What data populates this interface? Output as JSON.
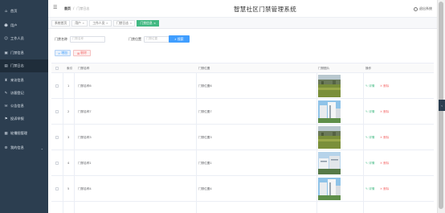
{
  "sidebar": {
    "items": [
      {
        "label": "首页",
        "icon": "home-icon",
        "glyph": "⌂"
      },
      {
        "label": "用户",
        "icon": "user-icon",
        "glyph": "☻"
      },
      {
        "label": "工作人员",
        "icon": "staff-icon",
        "glyph": "☺"
      },
      {
        "label": "门禁信息",
        "icon": "doorcard-icon",
        "glyph": "▣"
      },
      {
        "label": "门禁日志",
        "icon": "log-icon",
        "glyph": "▤"
      },
      {
        "label": "来访信息",
        "icon": "visitor-icon",
        "glyph": "♜"
      },
      {
        "label": "访客登记",
        "icon": "register-icon",
        "glyph": "✎"
      },
      {
        "label": "公告信息",
        "icon": "notice-icon",
        "glyph": "✉"
      },
      {
        "label": "投诉举报",
        "icon": "complaint-icon",
        "glyph": "⚑"
      },
      {
        "label": "轮播图管理",
        "icon": "carousel-icon",
        "glyph": "▦"
      },
      {
        "label": "我的信息",
        "icon": "profile-icon",
        "glyph": "⚙"
      }
    ],
    "active_index": 4,
    "expand_glyph": "⌄"
  },
  "header": {
    "menu_glyph": "☰",
    "breadcrumb_home": "首页",
    "breadcrumb_sep": "/",
    "breadcrumb_current": "门禁日志",
    "title": "智慧社区门禁管理系统",
    "logout": "退出系统"
  },
  "tabs": [
    {
      "label": "系统首页",
      "closable": false,
      "active": false
    },
    {
      "label": "用户",
      "closable": true,
      "active": false
    },
    {
      "label": "工作人员",
      "closable": true,
      "active": false
    },
    {
      "label": "门禁日志",
      "closable": true,
      "active": false
    },
    {
      "label": "门禁信息",
      "closable": true,
      "active": true
    }
  ],
  "tab_close_glyph": "×",
  "search": {
    "name_label": "门禁名称",
    "name_placeholder": "门禁名称",
    "location_label": "门禁位置",
    "location_placeholder": "门禁位置",
    "button": "搜索",
    "button_glyph": "⌕"
  },
  "toolbar": {
    "add": "增加",
    "add_glyph": "+",
    "delete": "删除",
    "delete_glyph": "⊠"
  },
  "table": {
    "headers": {
      "index": "索引",
      "name": "门禁名称",
      "location": "门禁位置",
      "image": "门禁图片",
      "action": "操作"
    },
    "rows": [
      {
        "index": "1",
        "name": "门禁名称6",
        "location": "门禁位置6",
        "image_kind": "field"
      },
      {
        "index": "2",
        "name": "门禁名称7",
        "location": "门禁位置7",
        "image_kind": "tower"
      },
      {
        "index": "3",
        "name": "门禁名称3",
        "location": "门禁位置3",
        "image_kind": "field"
      },
      {
        "index": "4",
        "name": "门禁名称1",
        "location": "门禁位置1",
        "image_kind": "building"
      },
      {
        "index": "5",
        "name": "门禁名称4",
        "location": "门禁位置4",
        "image_kind": "tower"
      }
    ],
    "detail_label": "详情",
    "delete_label": "删除"
  },
  "colors": {
    "sidebar_bg": "#2c3e50",
    "accent_green": "#42b983",
    "primary_blue": "#409eff",
    "danger_red": "#f56c6c"
  }
}
